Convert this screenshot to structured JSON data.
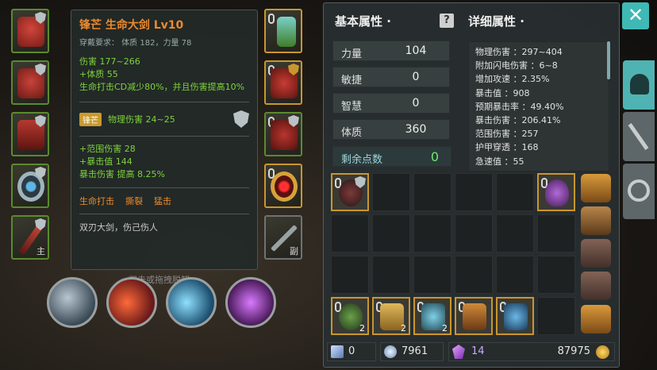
{
  "tooltip": {
    "title": "锋芒 生命大剑 Lv10",
    "requirement": "穿戴要求：  体质 182，力量 78",
    "damage": "伤害  177~266",
    "bonus_con": "+体质 55",
    "effect": "生命打击CD减少80%，并且伤害提高10%",
    "gem_tag": "锋芒",
    "gem_text": "物理伤害 24~25",
    "affixes": [
      "+范围伤害  28",
      "+暴击值  144",
      "暴击伤害  提高  8.25%"
    ],
    "skills": [
      "生命打击",
      "撕裂",
      "猛击"
    ],
    "description": "双刃大剑，伤己伤人"
  },
  "slot_tags": {
    "main": "主",
    "secondary": "副"
  },
  "unequip_hint": "双击或拖拽脱卸",
  "basic_header": "基本属性 ·",
  "detail_header": "详细属性 ·",
  "basic_stats": [
    {
      "label": "力量",
      "value": "104"
    },
    {
      "label": "敏捷",
      "value": "0"
    },
    {
      "label": "智慧",
      "value": "0"
    },
    {
      "label": "体质",
      "value": "360"
    }
  ],
  "remaining_points": {
    "label": "剩余点数",
    "value": "0"
  },
  "detail_stats": [
    "物理伤害 ：297~404",
    "附加闪电伤害 ：6~8",
    "增加攻速 ：2.35%",
    "暴击值 ：908",
    "预期暴击率 ：49.40%",
    "暴击伤害 ：206.41%",
    "范围伤害 ：257",
    "护甲穿透 ：168",
    "急速值 ：55"
  ],
  "inventory_counts": [
    "2",
    "2",
    "2"
  ],
  "currency": {
    "scroll": "0",
    "soul": "7961",
    "crystal": "14",
    "gold": "87975"
  },
  "colors": {
    "accent_orange": "#ec8a2d",
    "green_stat": "#7fd23b",
    "slot_green": "#5a8a2e",
    "slot_gold": "#c9962e",
    "close_teal": "#3fb9b5"
  }
}
